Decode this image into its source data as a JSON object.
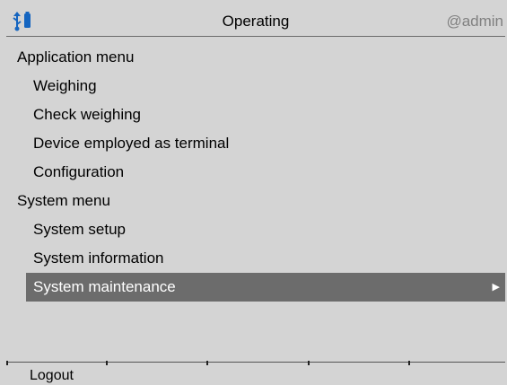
{
  "header": {
    "title": "Operating",
    "user": "@admin",
    "status_icon": "usb-connection-icon"
  },
  "menu": {
    "sections": [
      {
        "label": "Application menu",
        "items": [
          "Weighing",
          "Check weighing",
          "Device employed as terminal",
          "Configuration"
        ]
      },
      {
        "label": "System menu",
        "items": [
          "System setup",
          "System information",
          "System maintenance"
        ]
      }
    ],
    "selected_item": "System maintenance"
  },
  "softkeys": [
    "Logout",
    "",
    "",
    "",
    ""
  ],
  "colors": {
    "background": "#d4d4d4",
    "selection": "#6c6c6c",
    "icon_blue": "#1565c0"
  }
}
